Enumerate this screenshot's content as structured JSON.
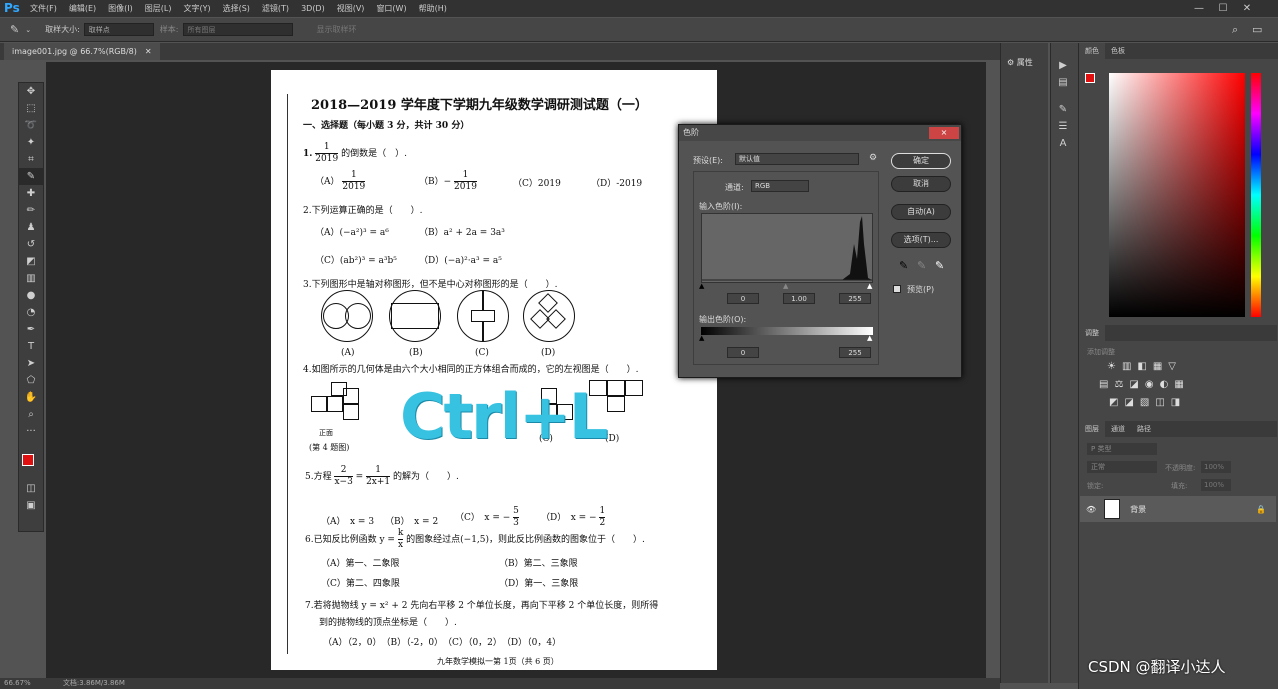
{
  "app": {
    "logo": "Ps",
    "menus": [
      "文件(F)",
      "编辑(E)",
      "图像(I)",
      "图层(L)",
      "文字(Y)",
      "选择(S)",
      "滤镜(T)",
      "3D(D)",
      "视图(V)",
      "窗口(W)",
      "帮助(H)"
    ]
  },
  "options": {
    "sample_size_label": "取样大小:",
    "sample_size_value": "取样点",
    "sample_label": "样本:",
    "sample_value": "所有图层",
    "ring_label": "显示取样环"
  },
  "document": {
    "tab_title": "image001.jpg @ 66.7%(RGB/8)"
  },
  "status": {
    "zoom": "66.67%",
    "doc": "文档:3.86M/3.86M"
  },
  "exam": {
    "title": "2018—2019 学年度下学期九年级数学调研测试题（一）",
    "section": "一、选择题（每小题 3 分，共计 30 分）",
    "q1_num": "1.",
    "q1_text": "的倒数是（　）.",
    "q1_frac": {
      "num": "1",
      "den": "2019"
    },
    "q1_a": "（A）",
    "q1_b": "（B）−",
    "q1_c": "（C）2019",
    "q1_d": "（D）-2019",
    "q2": "2.下列运算正确的是（　　）.",
    "q2_a": "（A）(−a²)³ = a⁶",
    "q2_b": "（B）a² + 2a = 3a³",
    "q2_c": "（C）(ab²)³ = a³b⁵",
    "q2_d": "（D）(−a)²·a³ = a⁵",
    "q3": "3.下列图形中是轴对称图形，但不是中心对称图形的是（　　）.",
    "q3_labels": [
      "(A)",
      "(B)",
      "(C)",
      "(D)"
    ],
    "q4": "4.如图所示的几何体是由六个大小相同的正方体组合而成的，它的左视图是（　　）.",
    "q4_caption": "(第 4 题图)",
    "q4_front": "正面",
    "q4_labels": [
      "(C)",
      "(D)"
    ],
    "q5_pre": "5.方程",
    "q5_post": "的解为（　　）.",
    "q5_f1": {
      "num": "2",
      "den": "x−3"
    },
    "q5_f2": {
      "num": "1",
      "den": "2x+1"
    },
    "q5_a": "（A）　x = 3",
    "q5_b": "（B）　x = 2",
    "q5_c": "（C）　x = −",
    "q5_c_frac": {
      "num": "5",
      "den": "3"
    },
    "q5_d": "（D）　x = −",
    "q5_d_frac": {
      "num": "1",
      "den": "2"
    },
    "q6_pre": "6.已知反比例函数 y =",
    "q6_post": "的图象经过点(−1,5)，则此反比例函数的图象位于（　　）.",
    "q6_frac": {
      "num": "k",
      "den": "x"
    },
    "q6_a": "（A）第一、二象限",
    "q6_b": "（B）第二、三象限",
    "q6_c": "（C）第二、四象限",
    "q6_d": "（D）第一、三象限",
    "q7": "7.若将抛物线 y = x² + 2 先向右平移 2 个单位长度，再向下平移 2 个单位长度，则所得",
    "q7b": "到的抛物线的顶点坐标是（　　）.",
    "q7_opts": "（A）（2，0）　（B）（-2，0）　（C）（0，2）　（D）（0，4）",
    "footer": "九年数学模拟一第 1页（共 6 页）"
  },
  "overlay": {
    "shortcut": "Ctrl+L"
  },
  "levels": {
    "title": "色阶",
    "close": "×",
    "preset_label": "预设(E):",
    "preset_value": "默认值",
    "channel_label": "通道:",
    "channel_value": "RGB",
    "input_label": "输入色阶(I):",
    "input_values": [
      "0",
      "1.00",
      "255"
    ],
    "output_label": "输出色阶(O):",
    "output_values": [
      "0",
      "255"
    ],
    "buttons": {
      "ok": "确定",
      "cancel": "取消",
      "auto": "自动(A)",
      "options": "选项(T)..."
    },
    "preview": "预览(P)"
  },
  "panels": {
    "properties_tab": "属性",
    "color_tabs": [
      "颜色",
      "色板"
    ],
    "adjust_tab": "调整",
    "adjust_sub": "添加调整",
    "layers_tabs": [
      "图层",
      "通道",
      "路径"
    ],
    "kind": "P 类型",
    "blend": "正常",
    "opacity_label": "不透明度:",
    "opacity": "100%",
    "lock_label": "锁定:",
    "fill_label": "填充:",
    "fill": "100%",
    "layer_name": "背景"
  },
  "watermark_text": "CSDN @翻译小达人",
  "colors": {
    "accent": "#31a8ff",
    "fg": "#e01010",
    "ctrl_l": "#36c2e0"
  }
}
